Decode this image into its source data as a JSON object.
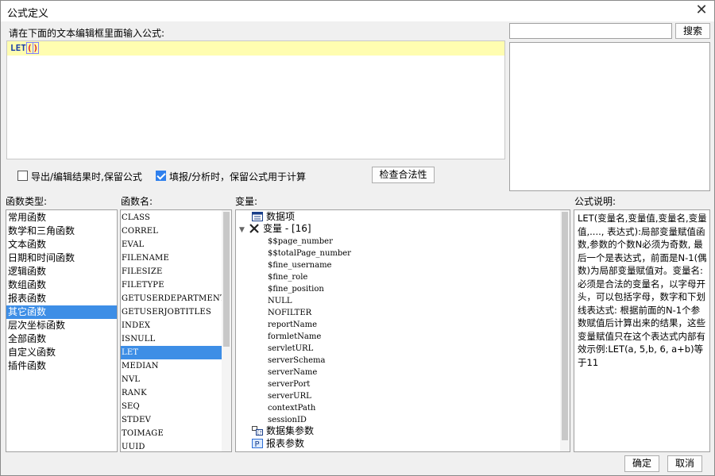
{
  "window": {
    "title": "公式定义"
  },
  "editor": {
    "label": "请在下面的文本编辑框里面输入公式:",
    "formula_keyword": "LET",
    "formula_open": "(",
    "formula_close": ")"
  },
  "search": {
    "placeholder": "",
    "button_label": "搜索"
  },
  "options": [
    {
      "label": "导出/编辑结果时,保留公式",
      "checked": false
    },
    {
      "label": "填报/分析时，保留公式用于计算",
      "checked": true
    }
  ],
  "check_button_label": "检查合法性",
  "function_types": {
    "header": "函数类型:",
    "items": [
      "常用函数",
      "数学和三角函数",
      "文本函数",
      "日期和时间函数",
      "逻辑函数",
      "数组函数",
      "报表函数",
      "其它函数",
      "层次坐标函数",
      "全部函数",
      "自定义函数",
      "插件函数"
    ],
    "selected": "其它函数"
  },
  "function_names": {
    "header": "函数名:",
    "items": [
      "CLASS",
      "CORREL",
      "EVAL",
      "FILENAME",
      "FILESIZE",
      "FILETYPE",
      "GETUSERDEPARTMENTS",
      "GETUSERJOBTITLES",
      "INDEX",
      "ISNULL",
      "LET",
      "MEDIAN",
      "NVL",
      "RANK",
      "SEQ",
      "STDEV",
      "TOIMAGE",
      "UUID"
    ],
    "selected": "LET"
  },
  "variables": {
    "header": "变量:",
    "data_items_label": "数据项",
    "var_group_label": "变量 - [16]",
    "vars": [
      "$$page_number",
      "$$totalPage_number",
      "$fine_username",
      "$fine_role",
      "$fine_position",
      "NULL",
      "NOFILTER",
      "reportName",
      "formletName",
      "servletURL",
      "serverSchema",
      "serverName",
      "serverPort",
      "serverURL",
      "contextPath",
      "sessionID"
    ],
    "dataset_params_label": "数据集参数",
    "report_params_label": "报表参数"
  },
  "description": {
    "header": "公式说明:",
    "text": "LET(变量名,变量值,变量名,变量值,...., 表达式):局部变量赋值函数,参数的个数N必须为奇数, 最后一个是表达式，前面是N-1(偶数)为局部变量赋值对。变量名: 必须是合法的变量名，以字母开头，可以包括字母，数字和下划线表达式: 根据前面的N-1个参数赋值后计算出来的结果，这些变量赋值只在这个表达式内部有效示例:LET(a, 5,b, 6, a+b)等于11"
  },
  "footer": {
    "ok_label": "确定",
    "cancel_label": "取消"
  }
}
